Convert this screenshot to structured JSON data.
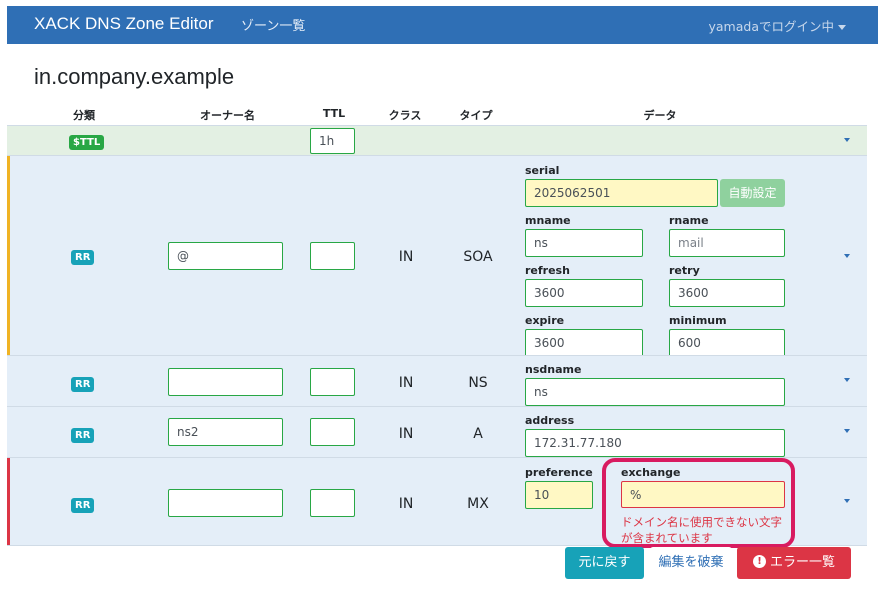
{
  "navbar": {
    "brand": "XACK DNS Zone Editor",
    "zone_list_link": "ゾーン一覧",
    "user_menu": "yamadaでログイン中"
  },
  "zone": {
    "name": "in.company.example"
  },
  "table": {
    "headers": {
      "category": "分類",
      "owner": "オーナー名",
      "ttl": "TTL",
      "class": "クラス",
      "type": "タイプ",
      "data": "データ"
    }
  },
  "ttl_row": {
    "badge": "$TTL",
    "value": "1h"
  },
  "soa_row": {
    "badge": "RR",
    "owner": "@",
    "ttl": "",
    "class": "IN",
    "type": "SOA",
    "labels": {
      "serial": "serial",
      "mname": "mname",
      "rname": "rname",
      "refresh": "refresh",
      "retry": "retry",
      "expire": "expire",
      "minimum": "minimum"
    },
    "values": {
      "serial": "2025062501",
      "mname": "ns",
      "rname": "mail",
      "refresh": "3600",
      "retry": "3600",
      "expire": "3600",
      "minimum": "600"
    },
    "auto_button": "自動設定"
  },
  "ns_row": {
    "badge": "RR",
    "owner": "",
    "ttl": "",
    "class": "IN",
    "type": "NS",
    "label": "nsdname",
    "value": "ns"
  },
  "a_row": {
    "badge": "RR",
    "owner": "ns2",
    "ttl": "",
    "class": "IN",
    "type": "A",
    "label": "address",
    "value": "172.31.77.180"
  },
  "mx_row": {
    "badge": "RR",
    "owner": "",
    "ttl": "",
    "class": "IN",
    "type": "MX",
    "pref_label": "preference",
    "pref_value": "10",
    "exch_label": "exchange",
    "exch_value": "%",
    "error_line1": "ドメイン名に使用できない文字",
    "error_line2": "が含まれています"
  },
  "actions": {
    "revert": "元に戻す",
    "discard": "編集を破棄",
    "errors": "エラー一覧"
  },
  "colors": {
    "navbar": "#2f6fb5",
    "soa_marker": "#f0b323",
    "error_marker": "#dc3545",
    "highlight": "#d81b60",
    "valid_border": "#28a745",
    "modified_field": "#fff8c4"
  },
  "icons": {
    "row_expand": "caret-down-icon",
    "errors_button": "exclamation-circle-icon",
    "user_menu": "caret-down-icon"
  }
}
